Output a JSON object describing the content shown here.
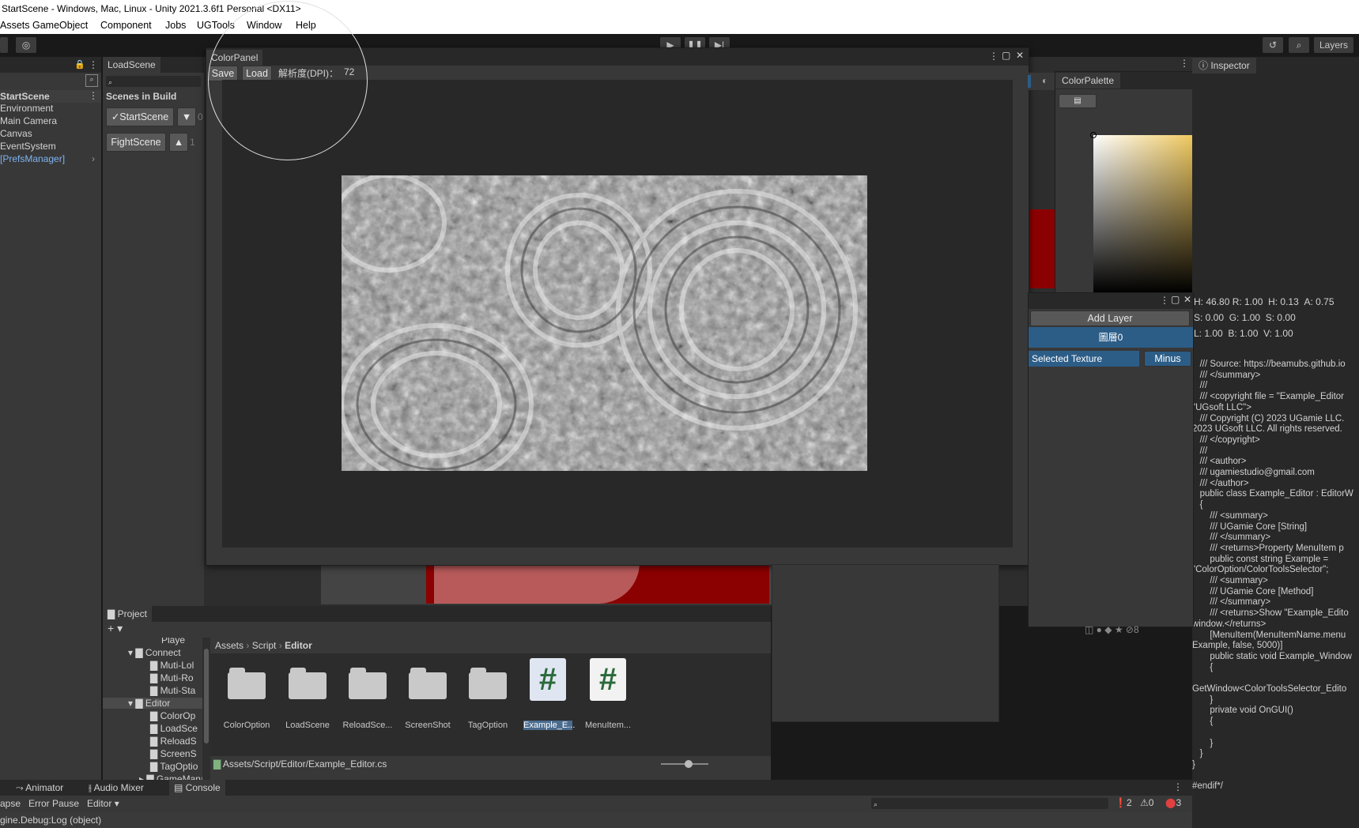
{
  "window": {
    "title": "StartScene - Windows, Mac, Linux - Unity 2021.3.6f1 Personal <DX11>"
  },
  "menu": [
    "Assets",
    "GameObject",
    "Component",
    "Jobs",
    "UGTools",
    "Window",
    "Help"
  ],
  "toolbar": {
    "layers_label": "Layers"
  },
  "hierarchy": {
    "scene": "StartScene",
    "items": [
      "Environment",
      "Main Camera",
      "Canvas",
      "EventSystem",
      "[PrefsManager]"
    ]
  },
  "loadscene": {
    "tab": "LoadScene",
    "header": "Scenes in Build",
    "scenes": [
      {
        "label": "✓StartScene",
        "index": "0"
      },
      {
        "label": "FightScene",
        "index": "1"
      }
    ]
  },
  "colorpanel": {
    "title": "ColorPanel",
    "save": "Save",
    "load": "Load",
    "dpi_label": "解析度(DPI)：",
    "dpi_value": "72"
  },
  "colorpalette": {
    "title": "ColorPalette",
    "values_row1": [
      "H: 46.80",
      "R: 1.00",
      "H: 0.13",
      "A: 0.75"
    ],
    "values_row2": [
      "S: 0.00",
      "G: 1.00",
      "S: 0.00"
    ],
    "values_row3": [
      "L: 1.00",
      "B: 1.00",
      "V: 1.00"
    ]
  },
  "layers": {
    "add_layer": "Add Layer",
    "layer0": "圖層0",
    "selected_texture": "Selected Texture",
    "minus": "Minus"
  },
  "inspector": {
    "tab": "Inspector"
  },
  "code_lines": [
    "   /// Source: https://beamubs.github.io",
    "   /// </summary>",
    "   ///",
    "   /// <copyright file = \"Example_Editor",
    "\"UGsoft LLC\">",
    "   /// Copyright (C) 2023 UGamie LLC.",
    "2023 UGsoft LLC. All rights reserved.",
    "   /// </copyright>",
    "   ///",
    "   /// <author>",
    "   /// ugamiestudio@gmail.com",
    "   /// </author>",
    "   public class Example_Editor : EditorW",
    "   {",
    "       /// <summary>",
    "       /// UGamie Core [String]",
    "       /// </summary>",
    "       /// <returns>Property MenuItem p",
    "       public const string Example =",
    "\"ColorOption/ColorToolsSelector\";",
    "       /// <summary>",
    "       /// UGamie Core [Method]",
    "       /// </summary>",
    "       /// <returns>Show \"Example_Edito",
    "window.</returns>",
    "       [MenuItem(MenuItemName.menu",
    "Example, false, 5000)]",
    "       public static void Example_Window",
    "       {",
    "",
    "GetWindow<ColorToolsSelector_Edito",
    "       }",
    "       private void OnGUI()",
    "       {",
    "",
    "       }",
    "   }",
    "}",
    "",
    "#endif*/"
  ],
  "project": {
    "tab": "Project",
    "tree": [
      "Playe",
      "Connect",
      "Muti-Lol",
      "Muti-Ro",
      "Muti-Sta",
      "Editor",
      "ColorOp",
      "LoadSce",
      "ReloadS",
      "ScreenS",
      "TagOptio",
      "GameMana"
    ],
    "breadcrumb": [
      "Assets",
      "Script",
      "Editor"
    ],
    "assets": [
      "ColorOption",
      "LoadScene",
      "ReloadSce...",
      "ScreenShot",
      "TagOption",
      "Example_E...",
      "MenuItem..."
    ],
    "path": "Assets/Script/Editor/Example_Editor.cs"
  },
  "bottom": {
    "tabs": [
      "Animator",
      "Audio Mixer",
      "Console"
    ],
    "collapse": "apse",
    "error_pause": "Error Pause",
    "editor": "Editor",
    "status": "gine.Debug:Log (object)",
    "counts": [
      "2",
      "0",
      "3"
    ]
  },
  "colors": {
    "accent": "#2c5d87",
    "dark_red": "#8b0000"
  }
}
